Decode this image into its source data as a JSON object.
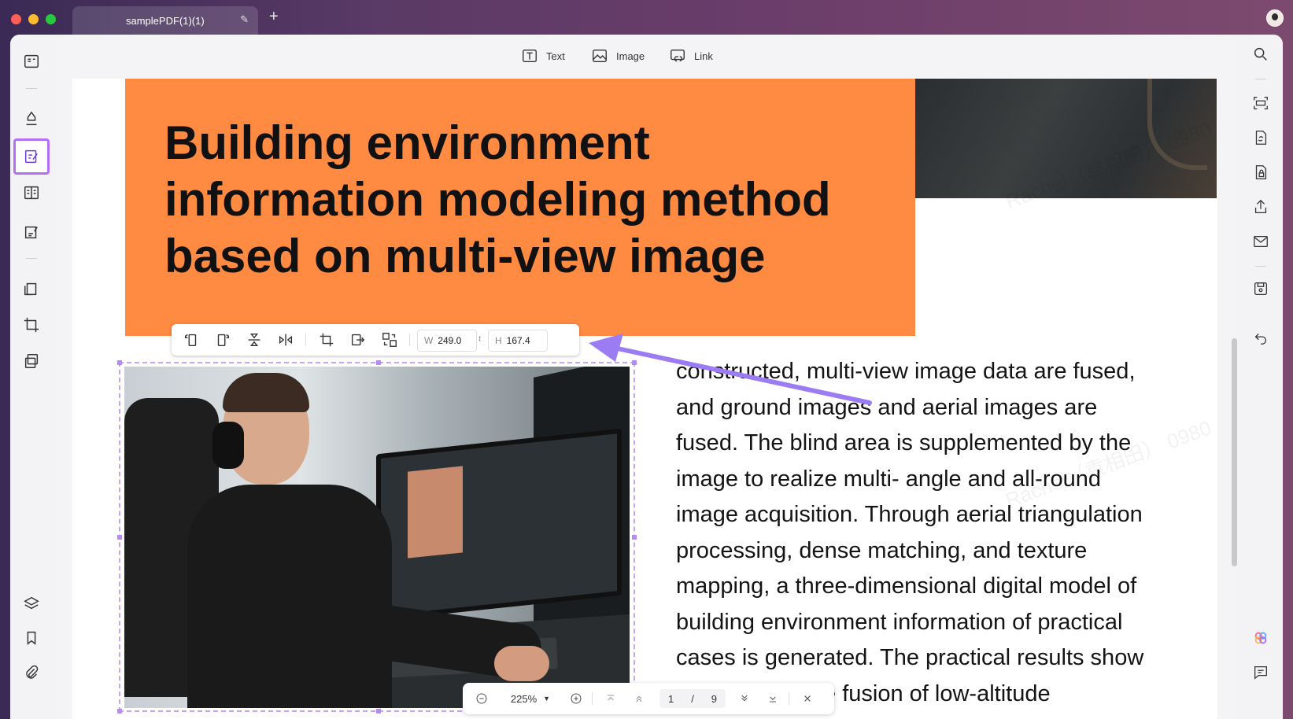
{
  "window": {
    "tab_title": "samplePDF(1)(1)",
    "tab_add": "+"
  },
  "toolbar": {
    "text_label": "Text",
    "image_label": "Image",
    "link_label": "Link"
  },
  "document": {
    "headline_lines": [
      "Building environment",
      "information modeling method",
      "based on multi-view image"
    ],
    "body_lines": [
      "constructed, multi-view image data are fused,",
      "and ground images and aerial images are",
      "fused. The blind area is supplemented by the",
      "image to realize multi- angle and all-round",
      "image acquisition. Through aerial triangulation",
      "processing, dense matching, and texture",
      "mapping, a three-dimensional digital model of",
      "building environment information of practical",
      "cases is generated. The practical results show",
      "that through the fusion of low-altitude"
    ],
    "watermark": "Rachel（袁相田） 0980"
  },
  "image_toolbar": {
    "width_label": "W",
    "width_value": "249.0",
    "height_label": "H",
    "height_value": "167.4"
  },
  "page_nav": {
    "zoom": "225%",
    "current_page": "1",
    "separator": "/",
    "total_pages": "9"
  },
  "colors": {
    "accent": "#b470f5",
    "headline_bg": "#ff8a42",
    "arrow": "#9b7cf2"
  }
}
